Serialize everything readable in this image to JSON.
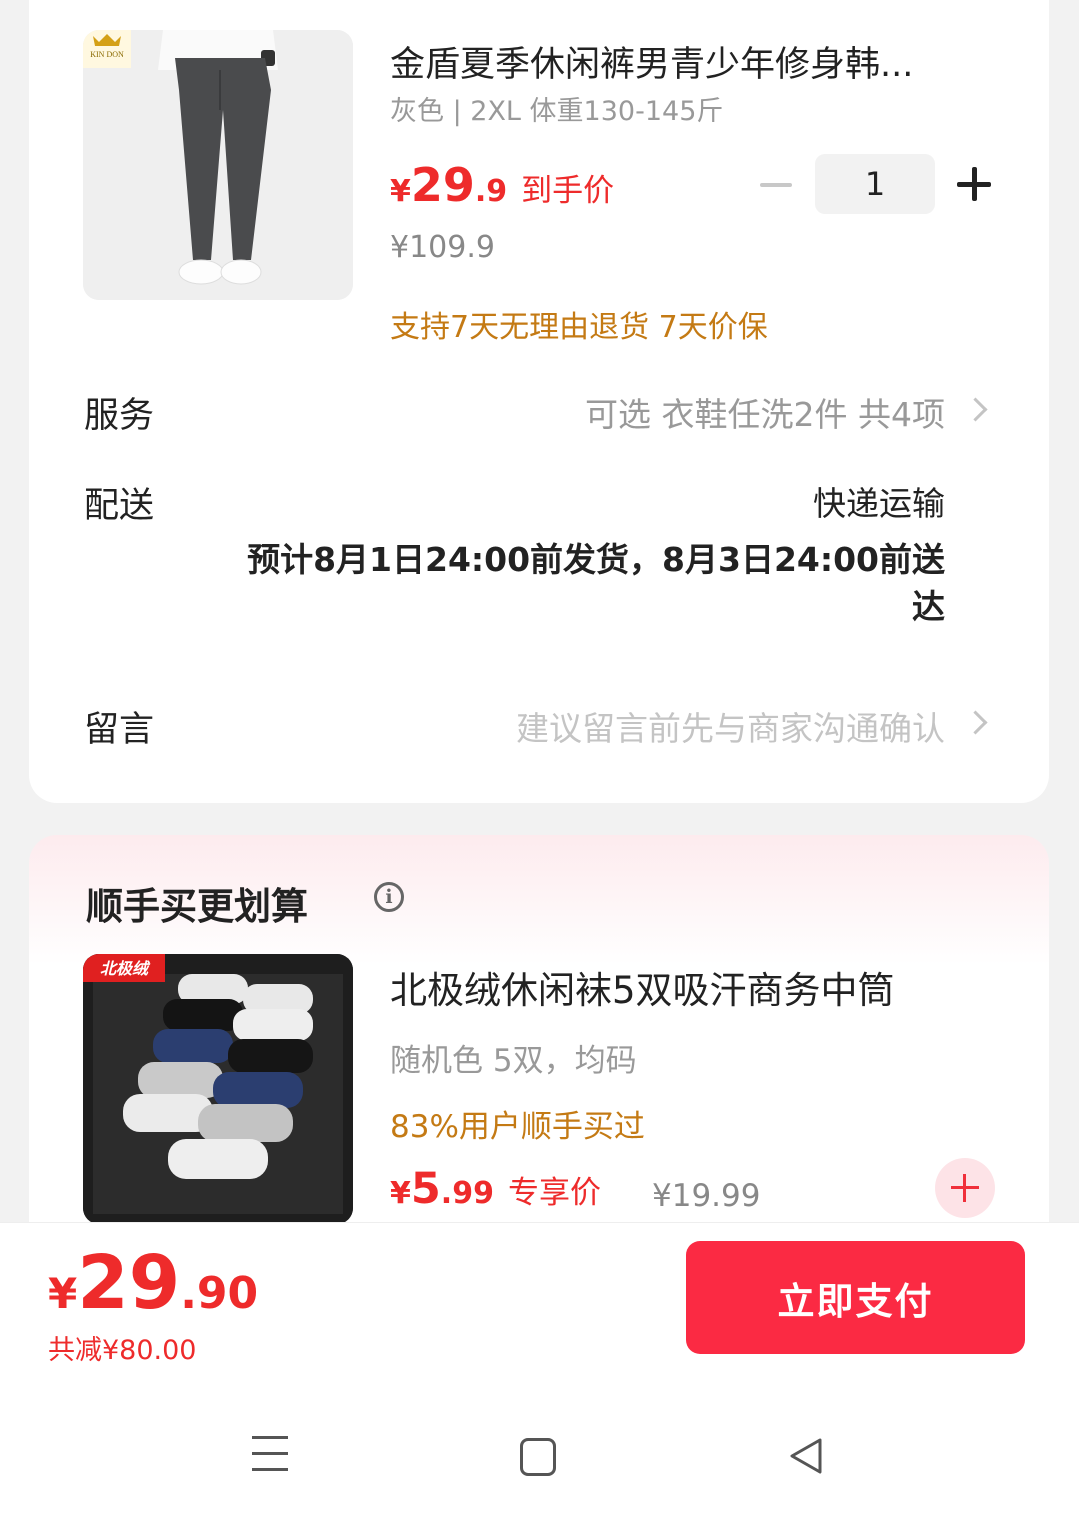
{
  "product": {
    "title": "金盾夏季休闲裤男青少年修身韩...",
    "spec": "灰色 | 2XL 体重130-145斤",
    "price_symbol": "¥",
    "price_int": "29",
    "price_dec": ".9",
    "price_tag": "到手价",
    "original_price": "¥109.9",
    "guarantee": "支持7天无理由退货  7天价保",
    "quantity": "1",
    "brand_logo_text": "KIN DON"
  },
  "service": {
    "label": "服务",
    "value": "可选 衣鞋任洗2件 共4项"
  },
  "delivery": {
    "label": "配送",
    "method": "快递运输",
    "estimate_line1": "预计8月1日24:00前发货，8月3日24:00前送",
    "estimate_line2": "达"
  },
  "message": {
    "label": "留言",
    "placeholder": "建议留言前先与商家沟通确认"
  },
  "addon": {
    "section_title": "顺手买更划算",
    "info_glyph": "i",
    "title": "北极绒休闲袜5双吸汗商务中筒",
    "spec": "随机色 5双，均码",
    "bought": "83%用户顺手买过",
    "price_symbol": "¥",
    "price_int": "5",
    "price_dec": ".99",
    "price_tag": "专享价",
    "original_price": "¥19.99",
    "brand_logo_text": "北极绒"
  },
  "footer": {
    "total_symbol": "¥",
    "total_int": "29",
    "total_dec": ".90",
    "discount": "共减¥80.00",
    "pay_label": "立即支付"
  },
  "colors": {
    "accent_red": "#ee2b2b",
    "pay_button": "#fb2a43",
    "orange_text": "#c47a14"
  }
}
